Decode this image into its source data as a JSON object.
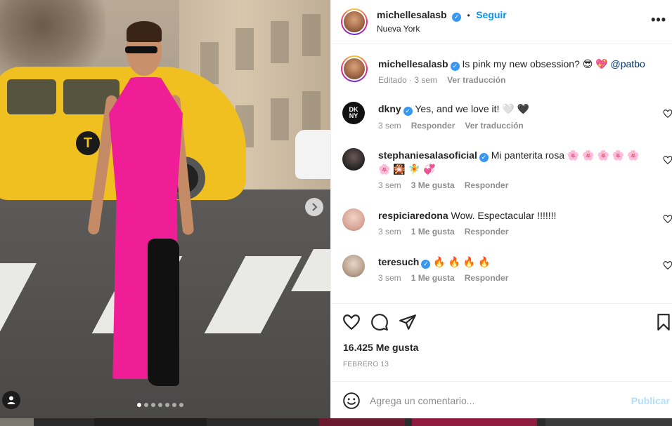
{
  "post": {
    "photo_dots_count": 7,
    "active_dot_index": 0
  },
  "header": {
    "username": "michellesalasb",
    "verified": true,
    "separator": "•",
    "follow_label": "Seguir",
    "location": "Nueva York",
    "more_label": "•••"
  },
  "caption": {
    "username": "michellesalasb",
    "text": "Is pink my new obsession? 😎 💖",
    "mention": "@patbo",
    "edited": "Editado",
    "time": "3 sem",
    "translate": "Ver traducción"
  },
  "comments": [
    {
      "username": "dkny",
      "verified": true,
      "text": "Yes, and we love it! 🤍 🖤",
      "time": "3 sem",
      "likes": "",
      "reply": "Responder",
      "translate": "Ver traducción"
    },
    {
      "username": "stephaniesalasoficial",
      "verified": true,
      "text": "Mi panterita rosa 🌸 🌸 🌸 🌸 🌸 🌸 🎇 🧚 💞",
      "time": "3 sem",
      "likes": "3 Me gusta",
      "reply": "Responder",
      "translate": ""
    },
    {
      "username": "respiciaredona",
      "verified": false,
      "text": "Wow. Espectacular !!!!!!!",
      "time": "3 sem",
      "likes": "1 Me gusta",
      "reply": "Responder",
      "translate": ""
    },
    {
      "username": "teresuch",
      "verified": true,
      "text": "🔥 🔥 🔥 🔥",
      "time": "3 sem",
      "likes": "1 Me gusta",
      "reply": "Responder",
      "translate": ""
    }
  ],
  "stats": {
    "likes": "16.425 Me gusta",
    "date": "FEBRERO 13"
  },
  "composer": {
    "placeholder": "Agrega un comentario...",
    "publish_label": "Publicar"
  },
  "colors": {
    "accent": "#0095f6",
    "verified": "#3897f0",
    "publish_disabled": "#b2dffc",
    "dress": "#f01e96",
    "taxi": "#f0c020"
  },
  "icons": {
    "like": "heart-icon",
    "comment": "comment-bubble-icon",
    "share": "paper-plane-icon",
    "save": "bookmark-icon",
    "emoji": "smiley-icon",
    "next": "chevron-right-icon",
    "tagged": "user-tag-icon"
  }
}
